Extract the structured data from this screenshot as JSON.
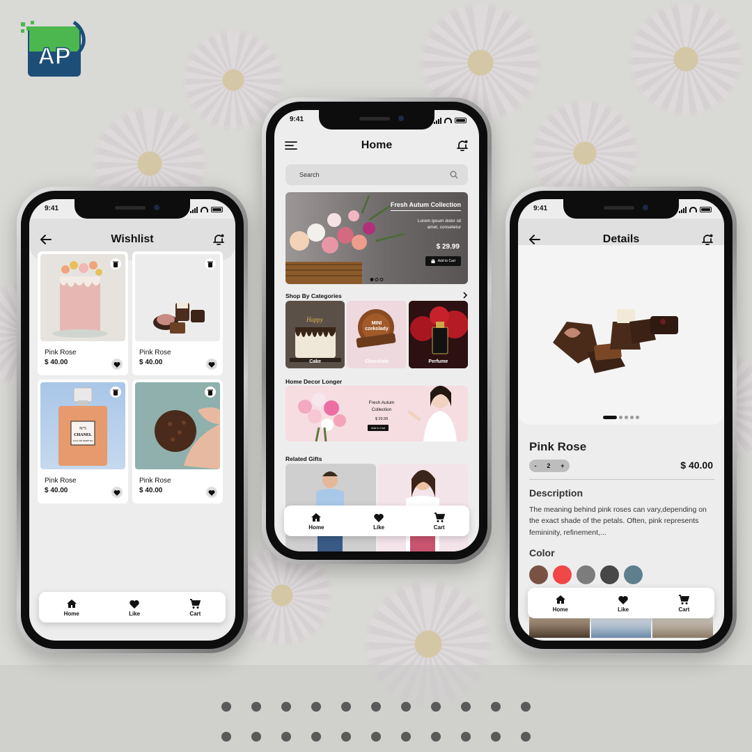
{
  "logo": {
    "text": "AP",
    "colors": {
      "green": "#4bb74e",
      "navy": "#1d4e78"
    }
  },
  "status_bar": {
    "time": "9:41"
  },
  "wishlist": {
    "title": "Wishlist",
    "items": [
      {
        "name": "Pink Rose",
        "price": "$ 40.00",
        "image": "layer-cake-image"
      },
      {
        "name": "Pink Rose",
        "price": "$ 40.00",
        "image": "chocolates-image"
      },
      {
        "name": "Pink Rose",
        "price": "$ 40.00",
        "image": "perfume-bottle-image"
      },
      {
        "name": "Pink Rose",
        "price": "$ 40.00",
        "image": "chocolate-truffle-image"
      }
    ]
  },
  "home": {
    "title": "Home",
    "search_placeholder": "Search",
    "banner": {
      "title": "Fresh Autum Collection",
      "subtitle": "Lorem ipsum dolor sit amet, consetetur",
      "price": "$ 29.99",
      "button": "Add to Cart"
    },
    "categories_title": "Shop By Categories",
    "categories": [
      {
        "label": "Cake"
      },
      {
        "label": "Chocolate",
        "badge_line1": "MINI",
        "badge_line2": "czekolady"
      },
      {
        "label": "Perfume"
      }
    ],
    "decor": {
      "section_title": "Home Decor Longer",
      "title": "Fresh Autum Collection",
      "price": "$ 29.99",
      "button": "Add to Cart"
    },
    "gifts_title": "Related Gifts"
  },
  "details": {
    "title": "Details",
    "product_name": "Pink Rose",
    "quantity": {
      "minus": "-",
      "value": "2",
      "plus": "+"
    },
    "price": "$ 40.00",
    "description_title": "Description",
    "description": "The meaning behind pink roses can vary,depending on the exact shade of the petals. Often, pink represents femininity, refinement,...",
    "color_title": "Color",
    "colors": [
      "#7a5244",
      "#f04747",
      "#7c7c7c",
      "#474747",
      "#5f7f8f"
    ]
  },
  "nav": {
    "home": "Home",
    "like": "Like",
    "cart": "Cart"
  },
  "icons": {
    "back": "arrow-left-icon",
    "bell": "bell-icon",
    "menu": "menu-icon",
    "search": "search-icon",
    "trash": "trash-icon",
    "heart": "heart-icon",
    "home": "home-icon",
    "cart": "cart-icon"
  }
}
